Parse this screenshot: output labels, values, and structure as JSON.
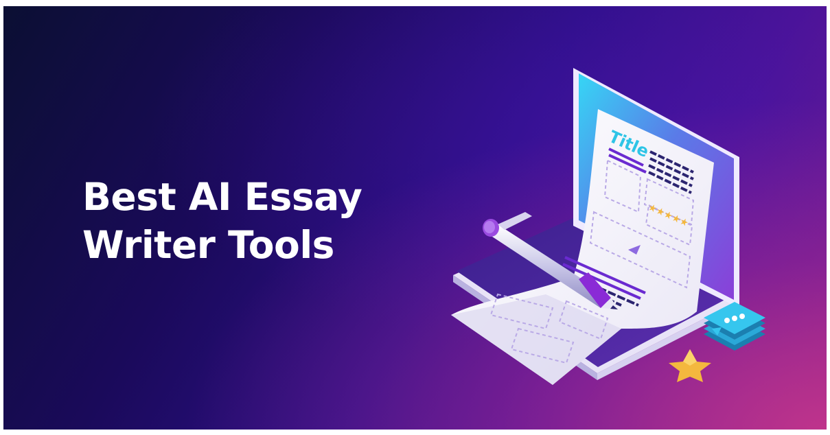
{
  "banner": {
    "headline_line1": "Best AI Essay",
    "headline_line2": "Writer Tools"
  },
  "illustration": {
    "document_title": "Title",
    "rating_stars": "★★★★★",
    "icons": [
      "laptop-icon",
      "document-icon",
      "pen-icon",
      "chat-bubble-icon",
      "star-icon",
      "play-icon"
    ]
  },
  "colors": {
    "background_dark": "#0b0f33",
    "background_purple": "#2c0f86",
    "background_pink": "#c8378c",
    "headline": "#ffffff",
    "title_text": "#2ec4e6",
    "lines_purple": "#6a2ad0",
    "star_gold": "#f4b83e",
    "chat_cyan": "#2ec4e6"
  }
}
